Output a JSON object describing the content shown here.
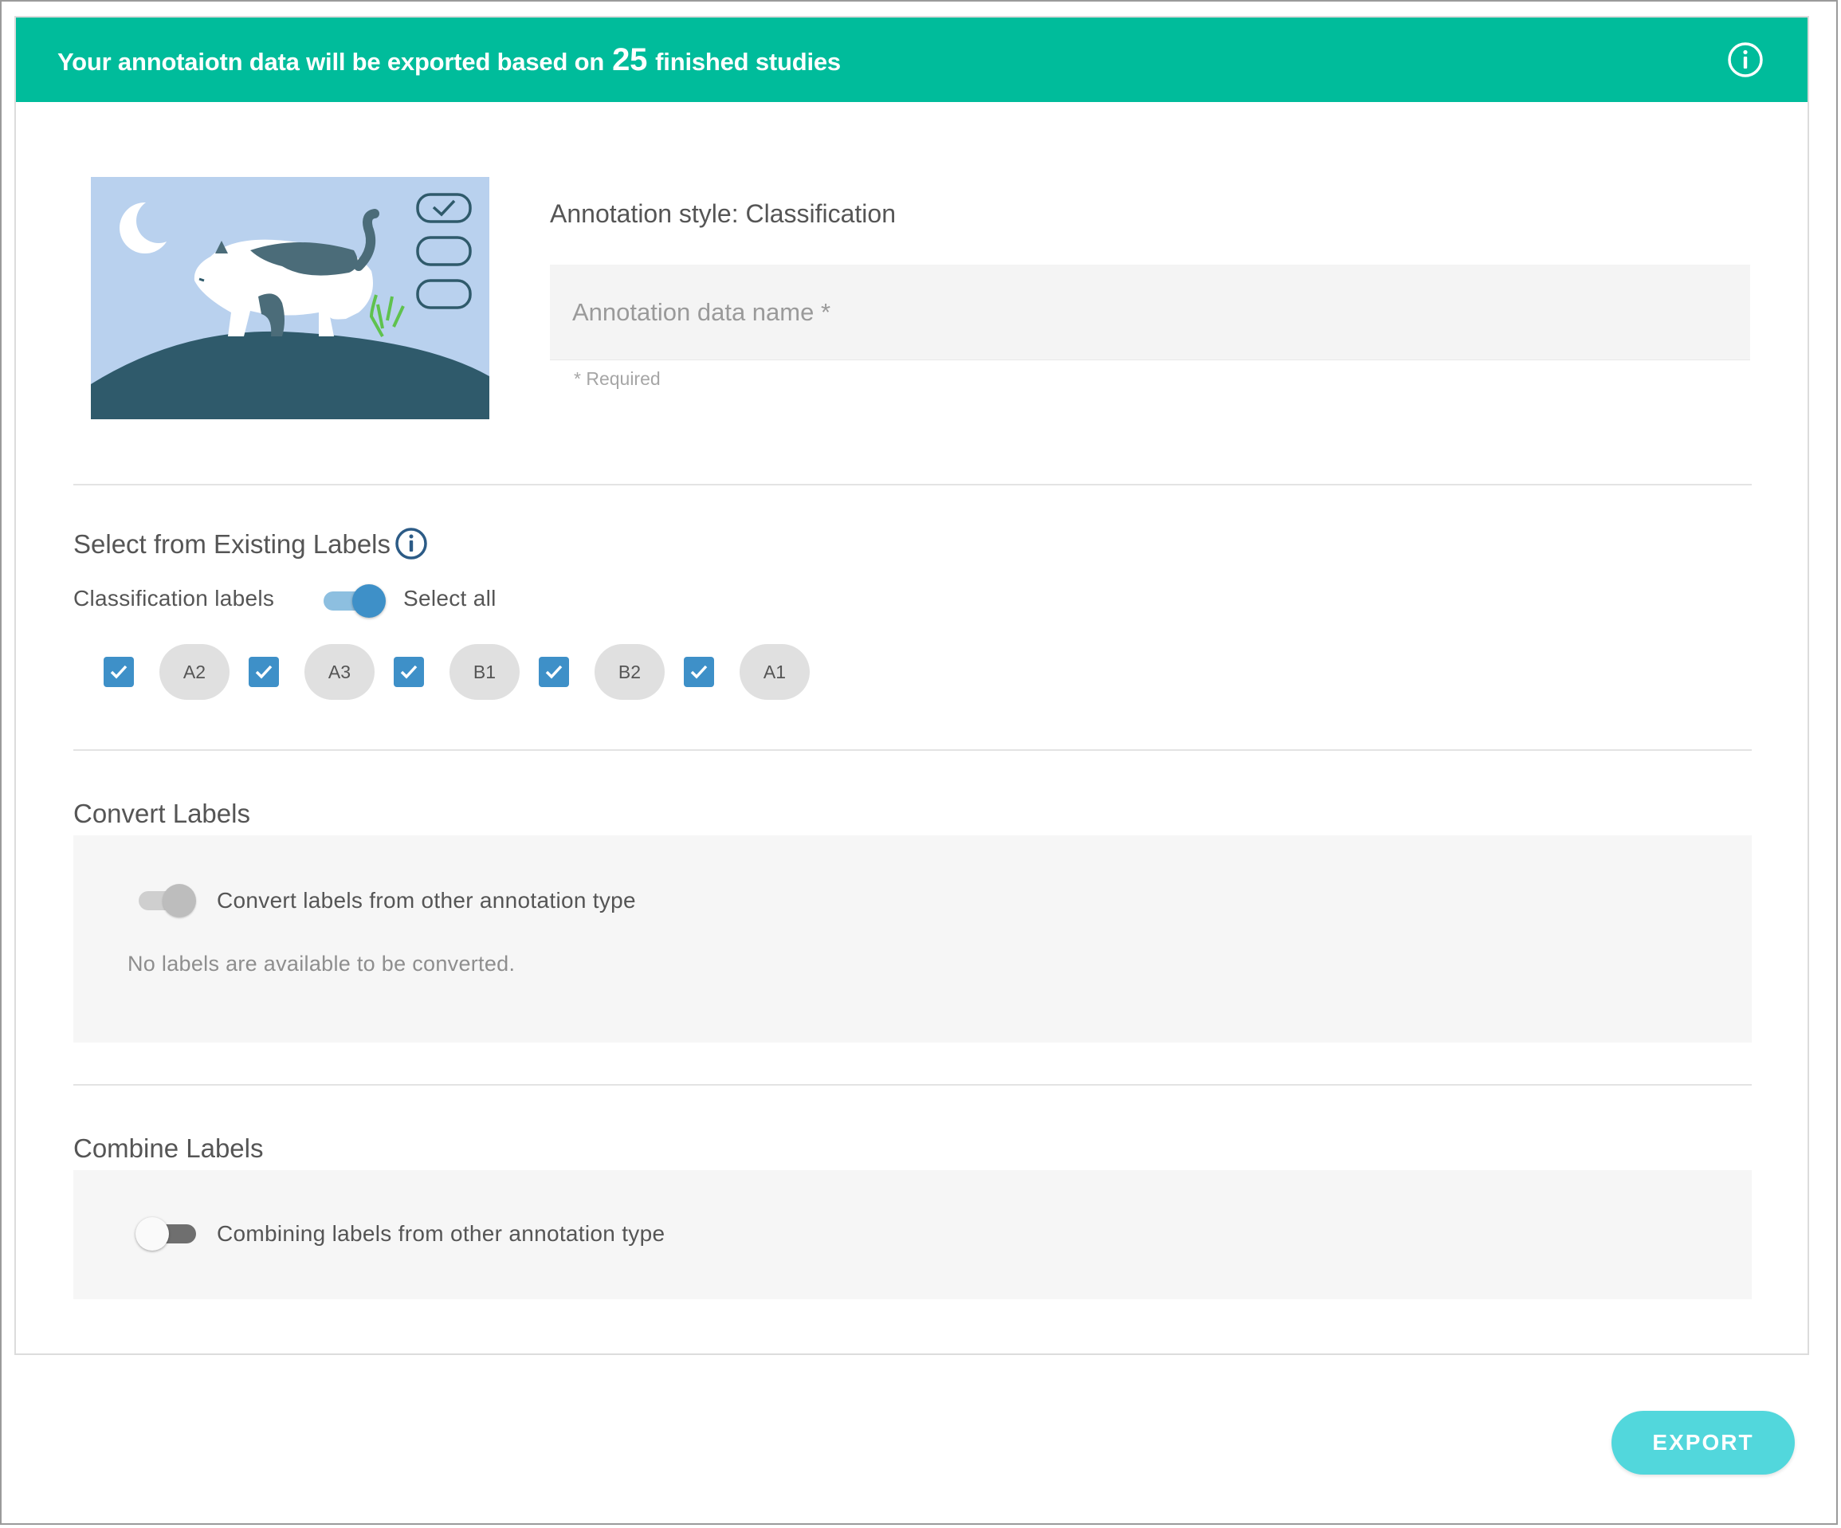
{
  "banner": {
    "text_before": "Your annotaiotn data will be exported based on",
    "count": "25",
    "text_after": "finished studies",
    "info_icon": "info-circle-icon",
    "color": "#00bc9b"
  },
  "form": {
    "annotation_style_label": "Annotation style: Classification",
    "name_placeholder": "Annotation data name *",
    "name_value": "",
    "required_hint": "* Required"
  },
  "existing_labels": {
    "title": "Select from Existing Labels",
    "info_icon": "info-circle-icon",
    "classification_label": "Classification labels",
    "select_all_label": "Select all",
    "select_all_on": true,
    "labels": [
      {
        "name": "A2",
        "checked": true
      },
      {
        "name": "A3",
        "checked": true
      },
      {
        "name": "B1",
        "checked": true
      },
      {
        "name": "B2",
        "checked": true
      },
      {
        "name": "A1",
        "checked": true
      }
    ],
    "checkbox_color": "#3e90c8"
  },
  "convert_labels": {
    "title": "Convert Labels",
    "toggle_label": "Convert labels from other annotation type",
    "toggle_on": false,
    "note": "No labels are available to be converted."
  },
  "combine_labels": {
    "title": "Combine Labels",
    "toggle_label": "Combining labels from other annotation type",
    "toggle_on": false
  },
  "actions": {
    "export_label": "EXPORT",
    "export_color": "#52d7dc"
  }
}
